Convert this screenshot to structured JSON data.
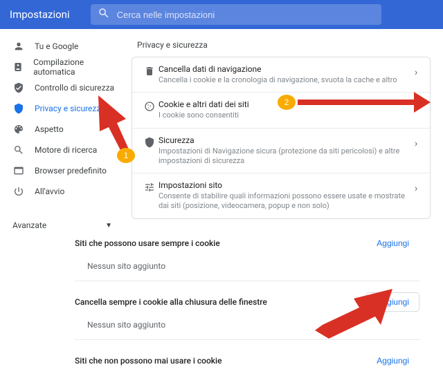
{
  "header": {
    "title": "Impostazioni",
    "search_placeholder": "Cerca nelle impostazioni"
  },
  "sidebar": {
    "items": [
      {
        "label": "Tu e Google"
      },
      {
        "label": "Compilazione automatica"
      },
      {
        "label": "Controllo di sicurezza"
      },
      {
        "label": "Privacy e sicurezza"
      },
      {
        "label": "Aspetto"
      },
      {
        "label": "Motore di ricerca"
      },
      {
        "label": "Browser predefinito"
      },
      {
        "label": "All'avvio"
      }
    ],
    "advanced_label": "Avanzate"
  },
  "main": {
    "section_title": "Privacy e sicurezza",
    "rows": [
      {
        "title": "Cancella dati di navigazione",
        "desc": "Cancella i cookie e la cronologia di navigazione, svuota la cache e altro"
      },
      {
        "title": "Cookie e altri dati dei siti",
        "desc": "I cookie sono consentiti"
      },
      {
        "title": "Sicurezza",
        "desc": "Impostazioni di Navigazione sicura (protezione da siti pericolosi) e altre impostazioni di sicurezza"
      },
      {
        "title": "Impostazioni sito",
        "desc": "Consente di stabilire quali informazioni possono essere usate e mostrate dai siti (posizione, videocamera, popup e non solo)"
      }
    ]
  },
  "lower": {
    "sections": [
      {
        "title": "Siti che possono usare sempre i cookie",
        "button": "Aggiungi",
        "empty": "Nessun sito aggiunto",
        "boxed": false
      },
      {
        "title": "Cancella sempre i cookie alla chiusura delle finestre",
        "button": "Aggiungi",
        "empty": "Nessun sito aggiunto",
        "boxed": true
      },
      {
        "title": "Siti che non possono mai usare i cookie",
        "button": "Aggiungi",
        "empty": "",
        "boxed": false
      }
    ]
  },
  "annotations": {
    "badge1": "1",
    "badge2": "2"
  }
}
